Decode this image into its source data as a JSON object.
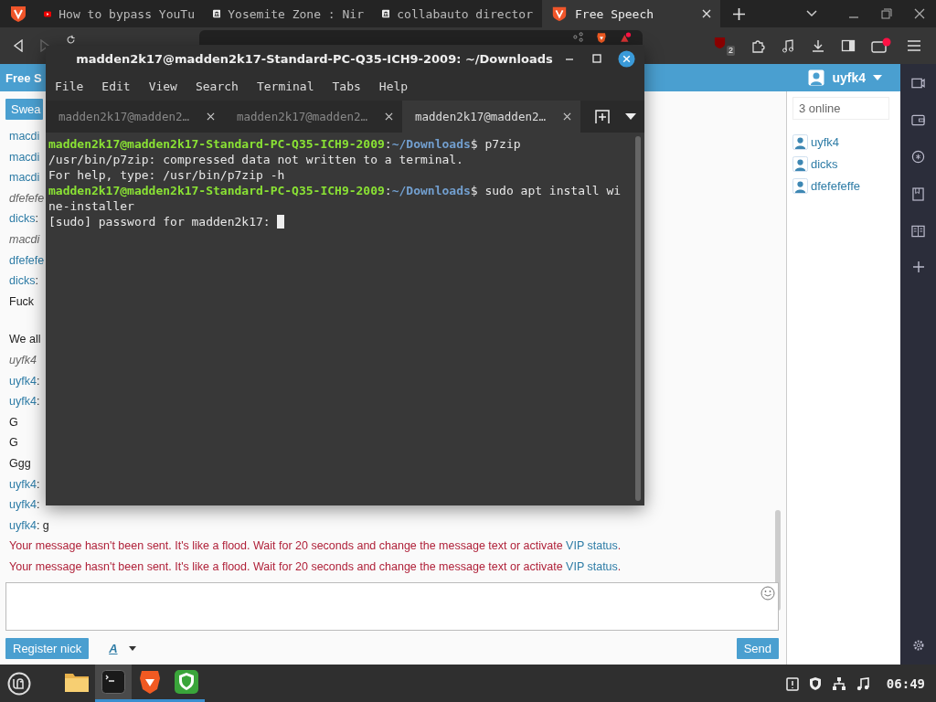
{
  "browser": {
    "tabs": [
      {
        "title": "How to bypass YouTu",
        "kind": "video",
        "selected": false
      },
      {
        "title": "Yosemite Zone : Nir",
        "kind": "building",
        "selected": false
      },
      {
        "title": "collabauto director",
        "kind": "building",
        "selected": false
      },
      {
        "title": "Free Speech",
        "kind": "logo",
        "selected": true
      }
    ],
    "extension_badge": "2"
  },
  "page": {
    "header_title": "Free S",
    "user": "uyfk4",
    "swear_button": "Swea",
    "messages": [
      {
        "kind": "user",
        "name": "macdi"
      },
      {
        "kind": "user",
        "name": "macdi"
      },
      {
        "kind": "user",
        "name": "macdi"
      },
      {
        "kind": "system",
        "text": "dfefefe"
      },
      {
        "kind": "user",
        "name": "dicks",
        "text": ":"
      },
      {
        "kind": "system",
        "text": "macdi"
      },
      {
        "kind": "user",
        "name": "dfefefe"
      },
      {
        "kind": "user",
        "name": "dicks",
        "text": ":"
      },
      {
        "kind": "plain",
        "text": "Fuck"
      },
      {
        "kind": "gap"
      },
      {
        "kind": "plain",
        "text": "We all"
      },
      {
        "kind": "system",
        "text": "uyfk4"
      },
      {
        "kind": "user",
        "name": "uyfk4",
        "text": ":"
      },
      {
        "kind": "user",
        "name": "uyfk4",
        "text": ":"
      },
      {
        "kind": "plain",
        "text": "G"
      },
      {
        "kind": "plain",
        "text": "G"
      },
      {
        "kind": "plain",
        "text": "Ggg"
      },
      {
        "kind": "user",
        "name": "uyfk4",
        "text": ":"
      },
      {
        "kind": "user",
        "name": "uyfk4",
        "text": ":"
      },
      {
        "kind": "user",
        "name": "uyfk4",
        "text": ": g"
      },
      {
        "kind": "error",
        "text": "Your message hasn't been sent. It's like a flood. Wait for 20 seconds and change the message text or activate ",
        "link": "VIP status",
        "suffix": "."
      },
      {
        "kind": "error",
        "text": "Your message hasn't been sent. It's like a flood. Wait for 20 seconds and change the message text or activate ",
        "link": "VIP status",
        "suffix": "."
      }
    ],
    "online_count": "3 online",
    "users": [
      "uyfk4",
      "dicks",
      "dfefefeffe"
    ],
    "register_button": "Register nick",
    "font_button": "A",
    "send_button": "Send"
  },
  "terminal": {
    "title": "madden2k17@madden2k17-Standard-PC-Q35-ICH9-2009: ~/Downloads",
    "menu": [
      "File",
      "Edit",
      "View",
      "Search",
      "Terminal",
      "Tabs",
      "Help"
    ],
    "tabs": [
      {
        "title": "madden2k17@madden2…",
        "selected": false
      },
      {
        "title": "madden2k17@madden2…",
        "selected": false
      },
      {
        "title": "madden2k17@madden2…",
        "selected": true
      }
    ],
    "lines": [
      {
        "kind": "prompt",
        "user": "madden2k17@madden2k17-Standard-PC-Q35-ICH9-2009",
        "sep": ":",
        "path": "~/Downloads",
        "command": "$ p7zip"
      },
      {
        "kind": "output",
        "text": "/usr/bin/p7zip: compressed data not written to a terminal."
      },
      {
        "kind": "output",
        "text": "For help, type: /usr/bin/p7zip -h"
      },
      {
        "kind": "prompt",
        "user": "madden2k17@madden2k17-Standard-PC-Q35-ICH9-2009",
        "sep": ":",
        "path": "~/Downloads",
        "command": "$ sudo apt install wi"
      },
      {
        "kind": "output",
        "text": "ne-installer"
      },
      {
        "kind": "input",
        "text": "[sudo] password for madden2k17: "
      }
    ]
  },
  "taskbar": {
    "apps": [
      {
        "kind": "folder",
        "running": false,
        "selected": false
      },
      {
        "kind": "terminal",
        "running": true,
        "selected": true
      },
      {
        "kind": "lion",
        "running": true,
        "selected": false
      },
      {
        "kind": "shield",
        "running": true,
        "selected": false
      }
    ],
    "time": "06:49"
  }
}
